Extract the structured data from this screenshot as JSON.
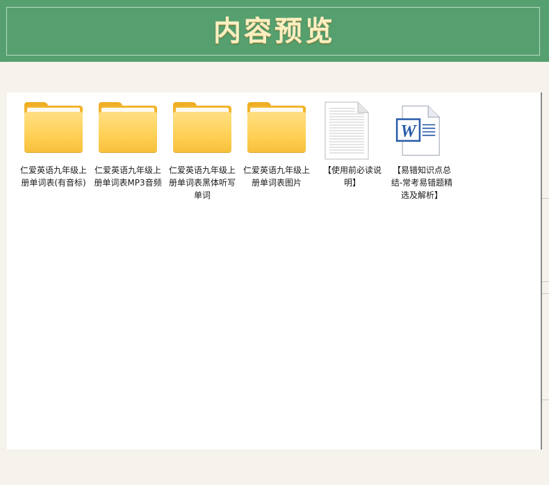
{
  "header": {
    "title": "内容预览"
  },
  "items": [
    {
      "type": "folder",
      "icon": "folder-icon",
      "label": "仁爱英语九年级上册单词表(有音标)"
    },
    {
      "type": "folder",
      "icon": "folder-icon",
      "label": "仁爱英语九年级上册单词表MP3音频"
    },
    {
      "type": "folder",
      "icon": "folder-icon",
      "label": "仁爱英语九年级上册单词表黑体听写单词"
    },
    {
      "type": "folder",
      "icon": "folder-icon",
      "label": "仁爱英语九年级上册单词表图片"
    },
    {
      "type": "text-file",
      "icon": "text-document-icon",
      "label": "【使用前必读说明】"
    },
    {
      "type": "word-file",
      "icon": "word-document-icon",
      "label": "【易错知识点总结-常考易错题精选及解析】"
    }
  ],
  "colors": {
    "banner": "#56a06f",
    "title": "#fbefc2",
    "background": "#f6f3ec",
    "panel": "#ffffff",
    "folder": "#ffd055",
    "word_blue": "#2a5caa"
  }
}
